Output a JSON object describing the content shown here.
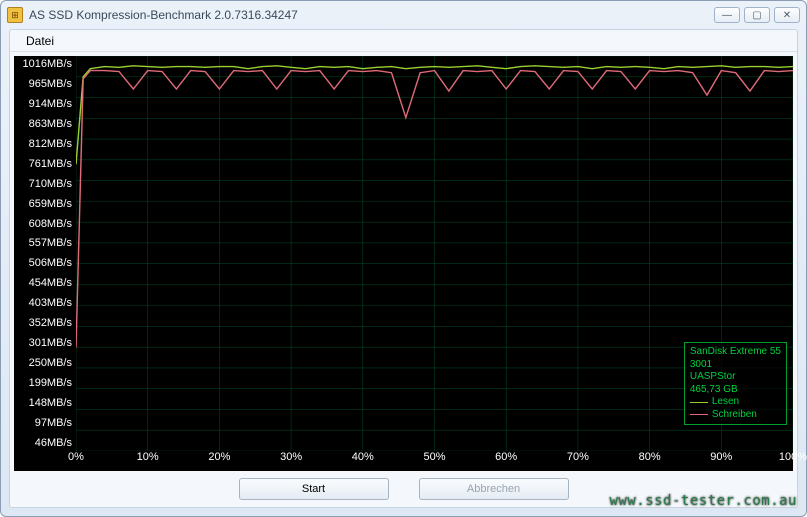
{
  "window": {
    "title": "AS SSD Kompression-Benchmark 2.0.7316.34247",
    "minimize": "—",
    "maximize": "▢",
    "close": "✕"
  },
  "menu": {
    "datei": "Datei"
  },
  "buttons": {
    "start": "Start",
    "cancel": "Abbrechen"
  },
  "legend": {
    "device": "SanDisk Extreme 55",
    "fw": "3001",
    "controller": "UASPStor",
    "capacity": "465,73 GB",
    "read": "Lesen",
    "write": "Schreiben"
  },
  "watermark": "www.ssd-tester.com.au",
  "chart_data": {
    "type": "line",
    "xlabel": "",
    "ylabel": "",
    "y_unit": "MB/s",
    "x_unit": "%",
    "xlim": [
      0,
      100
    ],
    "ylim": [
      46,
      1016
    ],
    "y_ticks": [
      1016,
      965,
      914,
      863,
      812,
      761,
      710,
      659,
      608,
      557,
      506,
      454,
      403,
      352,
      301,
      250,
      199,
      148,
      97,
      46
    ],
    "x_ticks": [
      0,
      10,
      20,
      30,
      40,
      50,
      60,
      70,
      80,
      90,
      100
    ],
    "series": [
      {
        "name": "Lesen",
        "color": "#9ad030",
        "x": [
          0,
          1,
          2,
          4,
          6,
          8,
          10,
          12,
          14,
          16,
          18,
          20,
          22,
          24,
          26,
          28,
          30,
          32,
          34,
          36,
          38,
          40,
          42,
          44,
          46,
          48,
          50,
          52,
          54,
          56,
          58,
          60,
          62,
          64,
          66,
          68,
          70,
          72,
          74,
          76,
          78,
          80,
          82,
          84,
          86,
          88,
          90,
          92,
          94,
          96,
          98,
          100
        ],
        "values": [
          750,
          965,
          985,
          990,
          988,
          992,
          990,
          988,
          990,
          990,
          988,
          990,
          990,
          985,
          990,
          992,
          988,
          985,
          990,
          988,
          990,
          985,
          988,
          990,
          985,
          988,
          990,
          988,
          990,
          992,
          988,
          985,
          990,
          992,
          990,
          988,
          990,
          985,
          990,
          988,
          990,
          988,
          985,
          990,
          988,
          990,
          992,
          988,
          990,
          990,
          988,
          990
        ]
      },
      {
        "name": "Schreiben",
        "color": "#e06a78",
        "x": [
          0,
          1,
          2,
          4,
          6,
          8,
          10,
          12,
          14,
          16,
          18,
          20,
          22,
          24,
          26,
          28,
          30,
          32,
          34,
          36,
          38,
          40,
          42,
          44,
          46,
          48,
          50,
          52,
          54,
          56,
          58,
          60,
          62,
          64,
          66,
          68,
          70,
          72,
          74,
          76,
          78,
          80,
          82,
          84,
          86,
          88,
          90,
          92,
          94,
          96,
          98,
          100
        ],
        "values": [
          300,
          960,
          980,
          980,
          978,
          935,
          980,
          978,
          935,
          980,
          978,
          935,
          980,
          978,
          980,
          935,
          980,
          978,
          980,
          935,
          980,
          978,
          980,
          975,
          865,
          975,
          980,
          930,
          980,
          978,
          980,
          935,
          980,
          978,
          935,
          980,
          978,
          935,
          980,
          978,
          935,
          980,
          978,
          980,
          975,
          920,
          980,
          975,
          930,
          980,
          978,
          980
        ]
      }
    ]
  }
}
